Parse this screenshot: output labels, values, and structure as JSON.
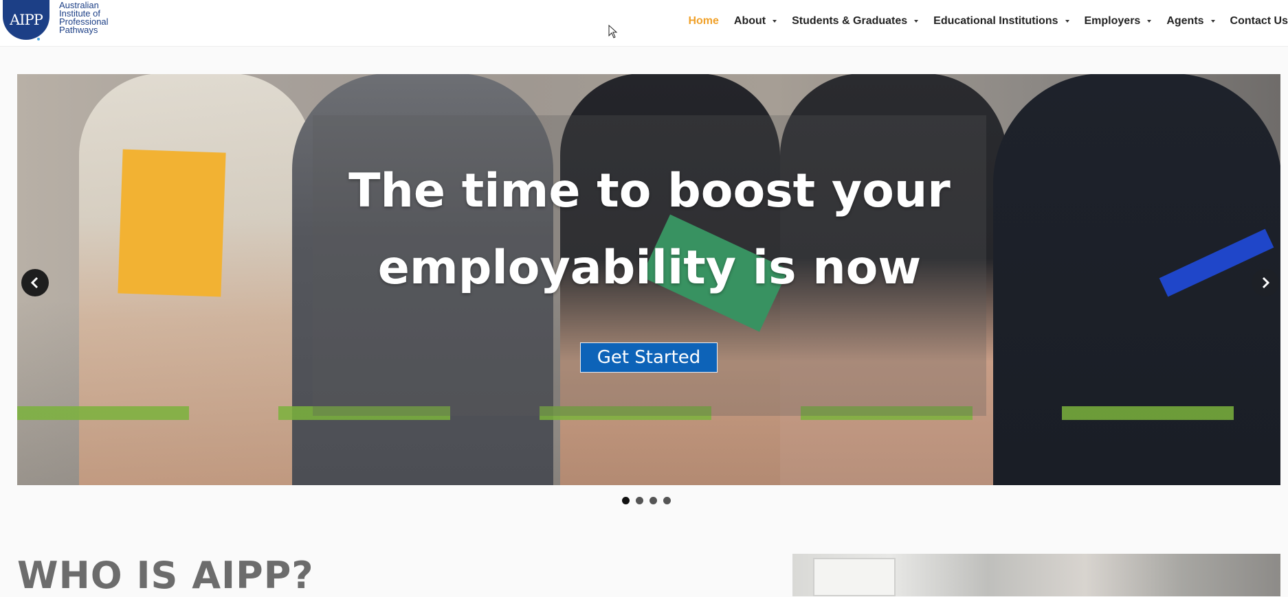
{
  "brand": {
    "logo_mark": "AIPP",
    "logo_text": "Australian\nInstitute of\nProfessional\nPathways",
    "primary_color": "#1c3f86",
    "accent_color": "#f0a12a"
  },
  "nav": {
    "items": [
      {
        "label": "Home",
        "active": true,
        "dropdown": false
      },
      {
        "label": "About",
        "active": false,
        "dropdown": true
      },
      {
        "label": "Students & Graduates",
        "active": false,
        "dropdown": true
      },
      {
        "label": "Educational Institutions",
        "active": false,
        "dropdown": true
      },
      {
        "label": "Employers",
        "active": false,
        "dropdown": true
      },
      {
        "label": "Agents",
        "active": false,
        "dropdown": true
      },
      {
        "label": "Contact Us",
        "active": false,
        "dropdown": false
      }
    ]
  },
  "hero": {
    "title": "The time to boost your employability is now",
    "cta_label": "Get Started",
    "cta_color": "#0d63b8",
    "prev_icon": "chevron-left-icon",
    "next_icon": "chevron-right-icon",
    "slide_count": 4,
    "active_slide": 1
  },
  "who": {
    "title": "WHO IS AIPP?"
  }
}
